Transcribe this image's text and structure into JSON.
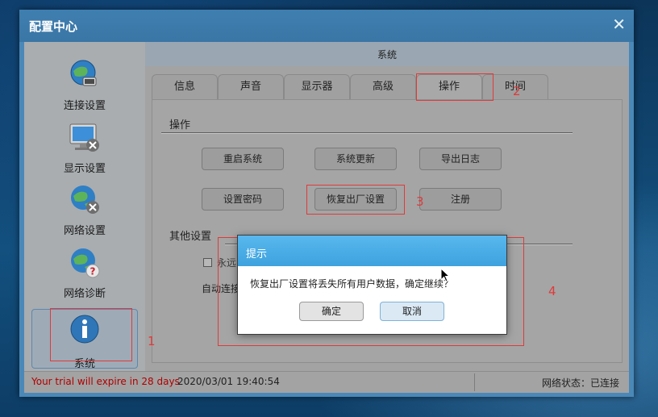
{
  "window": {
    "title": "配置中心",
    "close_glyph": "✕"
  },
  "sidebar": {
    "items": [
      {
        "label": "连接设置",
        "icon": "globe-connect-icon"
      },
      {
        "label": "显示设置",
        "icon": "monitor-tools-icon"
      },
      {
        "label": "网络设置",
        "icon": "globe-tools-icon"
      },
      {
        "label": "网络诊断",
        "icon": "globe-question-icon"
      },
      {
        "label": "系统",
        "icon": "info-icon",
        "active": true
      }
    ]
  },
  "content": {
    "header": "系统",
    "tabs": [
      {
        "label": "信息"
      },
      {
        "label": "声音"
      },
      {
        "label": "显示器"
      },
      {
        "label": "高级"
      },
      {
        "label": "操作",
        "active": true
      },
      {
        "label": "时间"
      }
    ],
    "operations": {
      "title": "操作",
      "buttons": [
        "重启系统",
        "系统更新",
        "导出日志",
        "设置密码",
        "恢复出厂设置",
        "注册"
      ]
    },
    "other": {
      "title": "其他设置",
      "checkbox_label": "永远",
      "auto_label": "自动连接"
    }
  },
  "status": {
    "trial": "Your trial will expire in 28 days",
    "datetime": "2020/03/01 19:40:54",
    "network": "网络状态：已连接"
  },
  "dialog": {
    "title": "提示",
    "message": "恢复出厂设置将丢失所有用户数据，确定继续？",
    "ok": "确定",
    "cancel": "取消"
  },
  "annotations": [
    "1",
    "2",
    "3",
    "4"
  ],
  "colors": {
    "annotation": "#e03a3a",
    "accent": "#3ea2de",
    "trial": "#b00000"
  }
}
